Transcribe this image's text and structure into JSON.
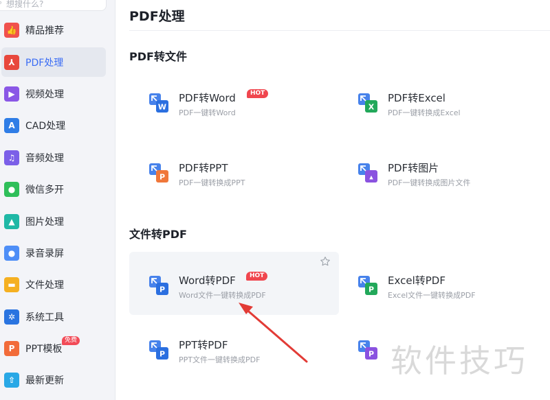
{
  "sidebar": {
    "search_placeholder": "想搜什么?",
    "items": [
      {
        "label": "精品推荐",
        "icon": "thumbs-up-icon",
        "color": "#f0514d"
      },
      {
        "label": "PDF处理",
        "icon": "pdf-icon",
        "color": "#e8473c",
        "active": true
      },
      {
        "label": "视频处理",
        "icon": "play-icon",
        "color": "#8a57e6"
      },
      {
        "label": "CAD处理",
        "icon": "cad-icon",
        "color": "#2f7de6"
      },
      {
        "label": "音频处理",
        "icon": "music-icon",
        "color": "#7b5fe8"
      },
      {
        "label": "微信多开",
        "icon": "wechat-icon",
        "color": "#2fbf5a"
      },
      {
        "label": "图片处理",
        "icon": "image-icon",
        "color": "#1fb8a6"
      },
      {
        "label": "录音录屏",
        "icon": "microphone-icon",
        "color": "#4e8ef7"
      },
      {
        "label": "文件处理",
        "icon": "folder-icon",
        "color": "#f5b021"
      },
      {
        "label": "系统工具",
        "icon": "gear-icon",
        "color": "#2a74e0"
      },
      {
        "label": "PPT模板",
        "icon": "ppt-icon",
        "color": "#f26c3a",
        "badge": "免费"
      },
      {
        "label": "最新更新",
        "icon": "upload-icon",
        "color": "#29a8e6"
      }
    ]
  },
  "main": {
    "title": "PDF处理",
    "sections": [
      {
        "title": "PDF转文件",
        "tools": [
          {
            "title": "PDF转Word",
            "desc": "PDF一键转Word",
            "hot": "HOT",
            "icon_letter": "W",
            "color": "#2b6fe0"
          },
          {
            "title": "PDF转Excel",
            "desc": "PDF一键转换成Excel",
            "icon_letter": "X",
            "color": "#22a85a"
          },
          {
            "title": "PDF转PPT",
            "desc": "PDF一键转换成PPT",
            "icon_letter": "P",
            "color": "#f0773a"
          },
          {
            "title": "PDF转图片",
            "desc": "PDF一键转换成图片文件",
            "icon_letter": "img",
            "color": "#8a52e0"
          }
        ]
      },
      {
        "title": "文件转PDF",
        "tools": [
          {
            "title": "Word转PDF",
            "desc": "Word文件一键转换成PDF",
            "hot": "HOT",
            "icon_letter": "P",
            "color": "#2b6fe0",
            "hovered": true
          },
          {
            "title": "Excel转PDF",
            "desc": "Excel文件一键转换成PDF",
            "icon_letter": "P",
            "color": "#22a85a"
          },
          {
            "title": "PPT转PDF",
            "desc": "PPT文件一键转换成PDF",
            "icon_letter": "P",
            "color": "#2b6fe0"
          },
          {
            "title": "",
            "desc": "",
            "icon_letter": "P",
            "color": "#8a52e0"
          }
        ]
      }
    ]
  },
  "watermark": "软件技巧"
}
